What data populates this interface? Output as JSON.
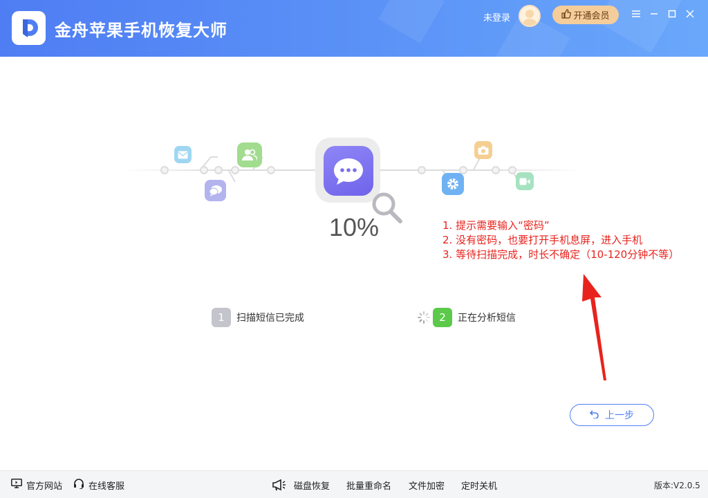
{
  "header": {
    "title": "金舟苹果手机恢复大师",
    "login_status": "未登录",
    "vip_button": "开通会员"
  },
  "progress": {
    "percent_text": "10%",
    "value": 0.1
  },
  "annotation": {
    "lines": [
      "1. 提示需要输入“密码”",
      "2. 没有密码，也要打开手机息屏，进入手机",
      "3. 等待扫描完成，时长不确定（10-120分钟不等）"
    ],
    "color": "#e8231e"
  },
  "steps": [
    {
      "number": "1",
      "label": "扫描短信已完成",
      "state": "done"
    },
    {
      "number": "2",
      "label": "正在分析短信",
      "state": "active"
    }
  ],
  "back_button": {
    "label": "上一步"
  },
  "footer": {
    "website": "官方网站",
    "support": "在线客服",
    "tools": [
      "磁盘恢复",
      "批量重命名",
      "文件加密",
      "定时关机"
    ],
    "version": "版本:V2.0.5"
  },
  "colors": {
    "brand": "#4f7df3",
    "step_done": "#c4c4cc",
    "step_active": "#5cc94b",
    "vip": "#f4cd9b"
  },
  "icons": [
    "app-logo-icon",
    "thumbs-up-icon",
    "minimize-icon",
    "maximize-icon",
    "close-icon",
    "mail-icon",
    "contacts-icon",
    "chat-icon",
    "message-icon",
    "search-icon",
    "settings-icon",
    "camera-icon",
    "video-icon",
    "loading-icon",
    "undo-icon",
    "monitor-icon",
    "headset-icon",
    "megaphone-icon"
  ]
}
